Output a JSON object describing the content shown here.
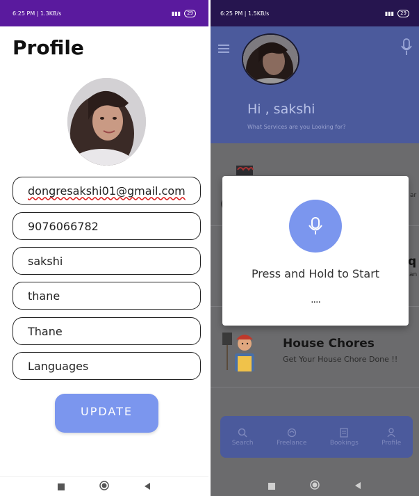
{
  "left_screen": {
    "status_bar": {
      "time": "6:25 PM | 1.3KB/s",
      "battery": "29"
    },
    "title": "Profile",
    "fields": {
      "email": "dongresakshi01@gmail.com",
      "phone": "9076066782",
      "name": "sakshi",
      "city": "thane",
      "district": "Thane",
      "languages": "Languages"
    },
    "update_label": "UPDATE"
  },
  "right_screen": {
    "status_bar": {
      "time": "6:25 PM | 1.5KB/s",
      "battery": "29"
    },
    "greeting": "Hi , sakshi",
    "subtitle": "What Services are you Looking for?",
    "services": [
      {
        "title": "House Chores",
        "subtitle": "Get Your House Chore Done !!"
      }
    ],
    "dialog": {
      "message": "Press and Hold to Start",
      "dots": "...."
    },
    "tabs": [
      {
        "label": "Search",
        "icon": "search-icon"
      },
      {
        "label": "Freelance",
        "icon": "freelance-icon"
      },
      {
        "label": "Bookings",
        "icon": "bookings-icon"
      },
      {
        "label": "Profile",
        "icon": "profile-icon"
      }
    ]
  },
  "colors": {
    "accent": "#7b96ee",
    "header": "#4b5a9c",
    "status_left": "#5a1a9e"
  }
}
